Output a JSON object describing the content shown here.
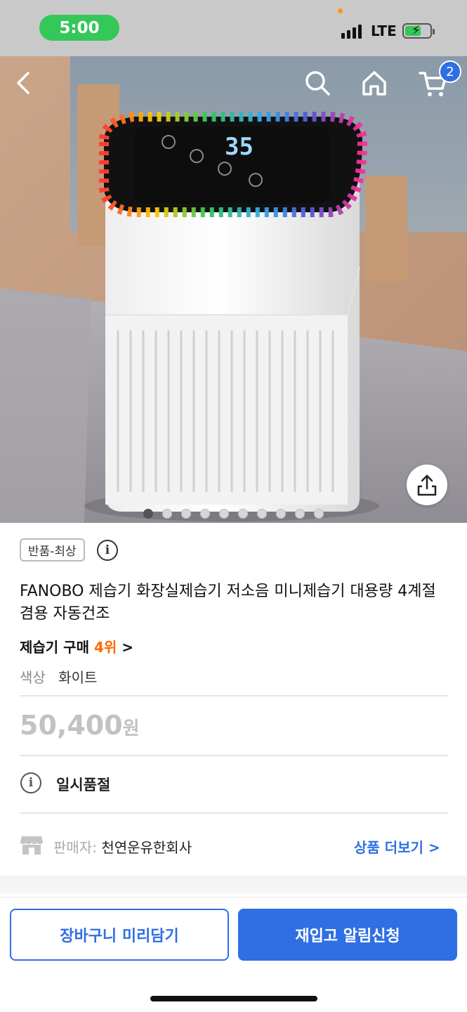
{
  "status_bar": {
    "time": "5:00",
    "network": "LTE",
    "battery_level": 0.65,
    "colors": {
      "time_pill": "#34c759",
      "battery_fill": "#34c759"
    }
  },
  "header": {
    "back_icon": "chevron-left-icon",
    "search_icon": "search-icon",
    "home_icon": "home-icon",
    "cart_icon": "cart-icon",
    "cart_count": "2"
  },
  "gallery": {
    "image_count": 10,
    "active_index": 0,
    "share_icon": "share-icon",
    "display_reading": "35"
  },
  "product": {
    "return_badge": "반품-최상",
    "title": "FANOBO 제습기 화장실제습기 저소음 미니제습기 대용량 4계절겸용 자동건조",
    "rank_prefix": "제습기 구매",
    "rank_value": "4위",
    "rank_chevron": ">",
    "option_label": "색상",
    "option_value": "화이트",
    "price": "50,400",
    "currency": "원",
    "stock_status": "일시품절",
    "seller_label": "판매자:",
    "seller_name": "천연운유한회사",
    "more_products": "상품 더보기",
    "more_chevron": ">"
  },
  "actions": {
    "add_to_cart": "장바구니 미리담기",
    "restock_alert": "재입고 알림신청",
    "accent_color": "#2f6fe4",
    "rank_color": "#ff6a00"
  }
}
